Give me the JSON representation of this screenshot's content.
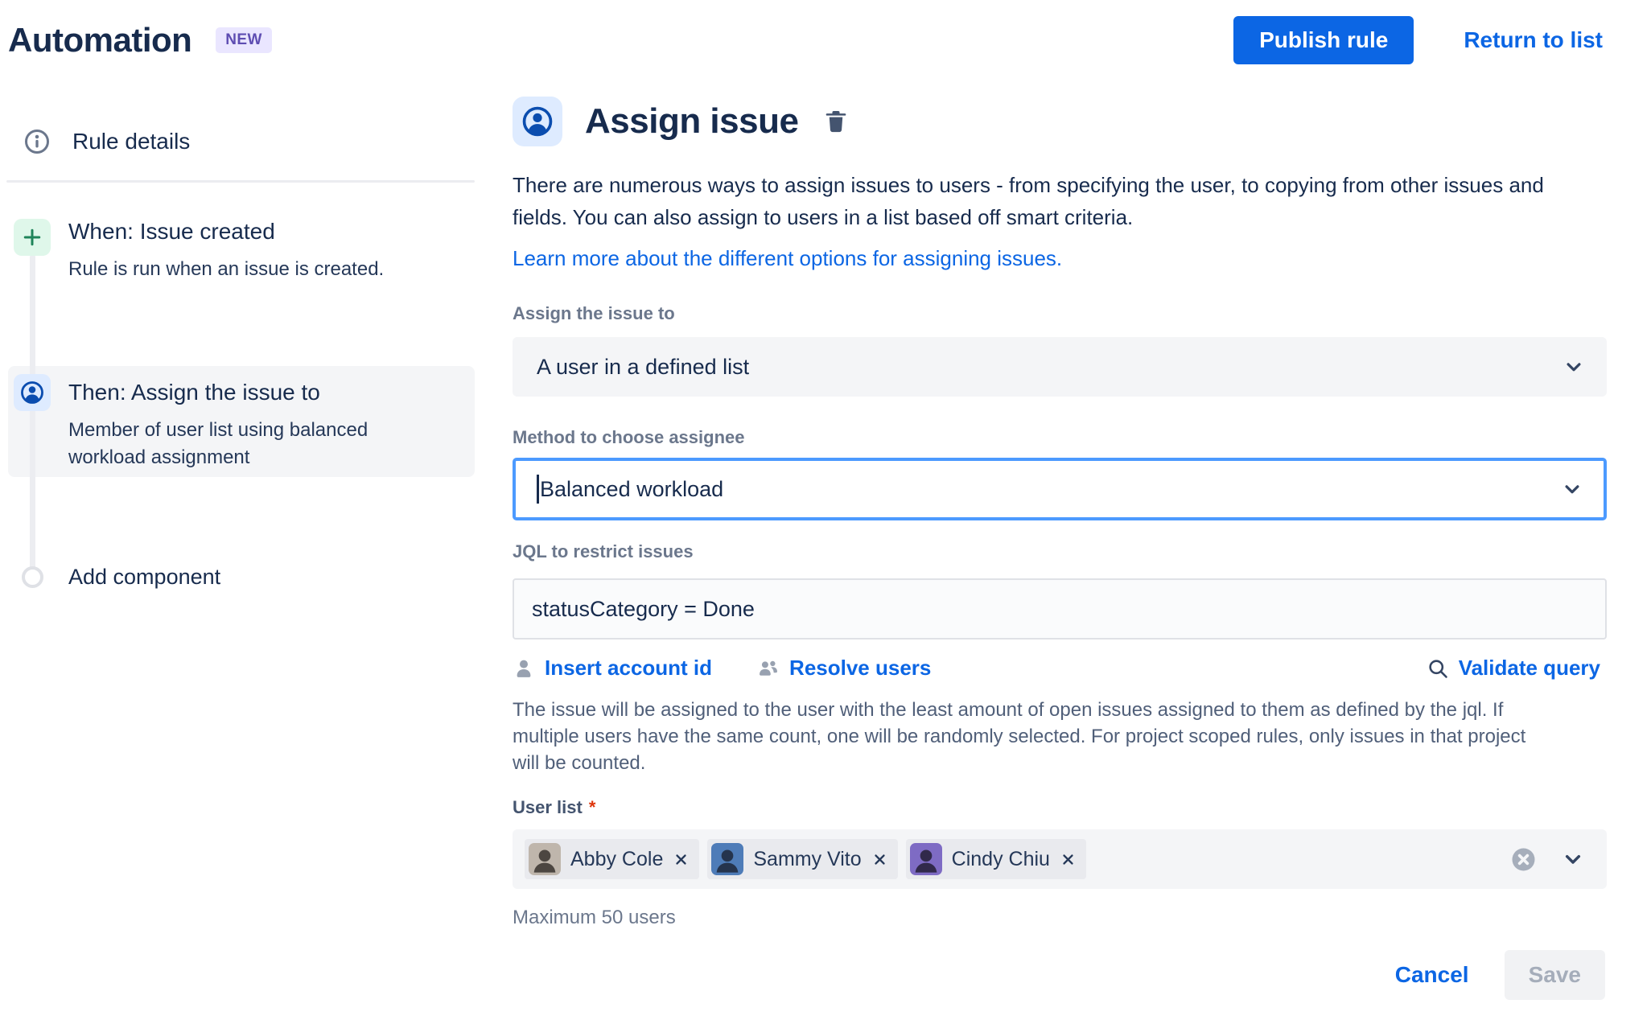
{
  "header": {
    "title": "Automation",
    "badge": "NEW",
    "publish_label": "Publish rule",
    "return_label": "Return to list"
  },
  "sidebar": {
    "rule_details_label": "Rule details",
    "items": [
      {
        "title": "When: Issue created",
        "subtitle": "Rule is run when an issue is created.",
        "icon": "plus-icon"
      },
      {
        "title": "Then: Assign the issue to",
        "subtitle": "Member of user list using balanced workload assignment",
        "icon": "user-avatar-icon",
        "selected": true
      }
    ],
    "add_component_label": "Add component"
  },
  "main": {
    "title": "Assign issue",
    "title_icon": "user-avatar-icon",
    "delete_icon": "trash-icon",
    "description": "There are numerous ways to assign issues to users - from specifying the user, to copying from other issues and fields. You can also assign to users in a list based off smart criteria.",
    "learn_more_link": "Learn more about the different options for assigning issues.",
    "assign_to": {
      "label": "Assign the issue to",
      "value": "A user in a defined list"
    },
    "method": {
      "label": "Method to choose assignee",
      "value": "Balanced workload",
      "focused": true
    },
    "jql": {
      "label": "JQL to restrict issues",
      "value": "statusCategory = Done"
    },
    "jql_actions": {
      "insert_account_id": "Insert account id",
      "resolve_users": "Resolve users",
      "validate_query": "Validate query"
    },
    "help_text": "The issue will be assigned to the user with the least amount of open issues assigned to them as defined by the jql. If multiple users have the same count, one will be randomly selected. For project scoped rules, only issues in that project will be counted.",
    "user_list": {
      "label": "User list",
      "required_marker": "*",
      "chips": [
        {
          "name": "Abby Cole",
          "avatar_bg": "#BFB6AC"
        },
        {
          "name": "Sammy Vito",
          "avatar_bg": "#4E7CB8"
        },
        {
          "name": "Cindy Chiu",
          "avatar_bg": "#7E6BC4"
        }
      ],
      "hint": "Maximum 50 users"
    },
    "footer": {
      "cancel_label": "Cancel",
      "save_label": "Save"
    }
  },
  "colors": {
    "accent_blue": "#0C66E4",
    "focus_border": "#4C9AFF",
    "icon_blue": "#0B4DAF",
    "icon_blue_bg": "#DEEBFF",
    "trigger_green": "#1F845A",
    "trigger_green_bg": "#DFF7EA",
    "badge_purple": "#5E4DB2",
    "badge_purple_bg": "#EAE6FF",
    "required_red": "#DE350B",
    "disabled_text": "#A5ADBA"
  }
}
